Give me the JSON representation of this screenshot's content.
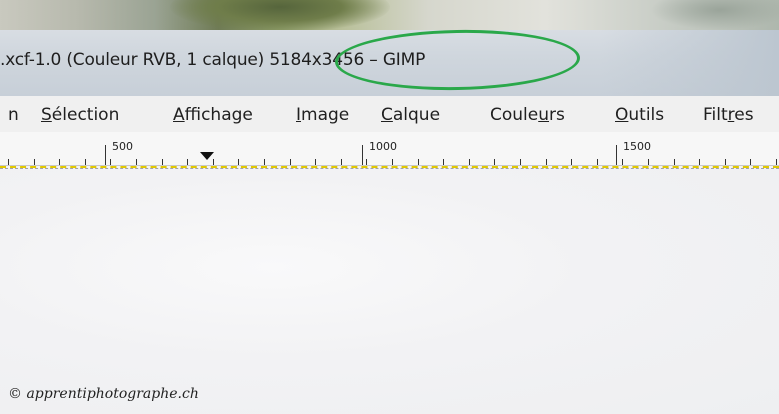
{
  "window": {
    "title": ".xcf-1.0 (Couleur RVB, 1 calque) 5184x3456 – GIMP"
  },
  "menu": {
    "items": [
      {
        "label": "n"
      },
      {
        "label": "Sélection"
      },
      {
        "label": "Affichage"
      },
      {
        "label": "Image"
      },
      {
        "label": "Calque"
      },
      {
        "label": "Couleurs"
      },
      {
        "label": "Outils"
      },
      {
        "label": "Filtres"
      }
    ]
  },
  "ruler": {
    "labels": [
      "500",
      "1000",
      "1500"
    ]
  },
  "watermark": {
    "text": "© apprentiphotographe.ch"
  },
  "colors": {
    "highlight": "#2aa84a",
    "guide": "#e0c800"
  }
}
